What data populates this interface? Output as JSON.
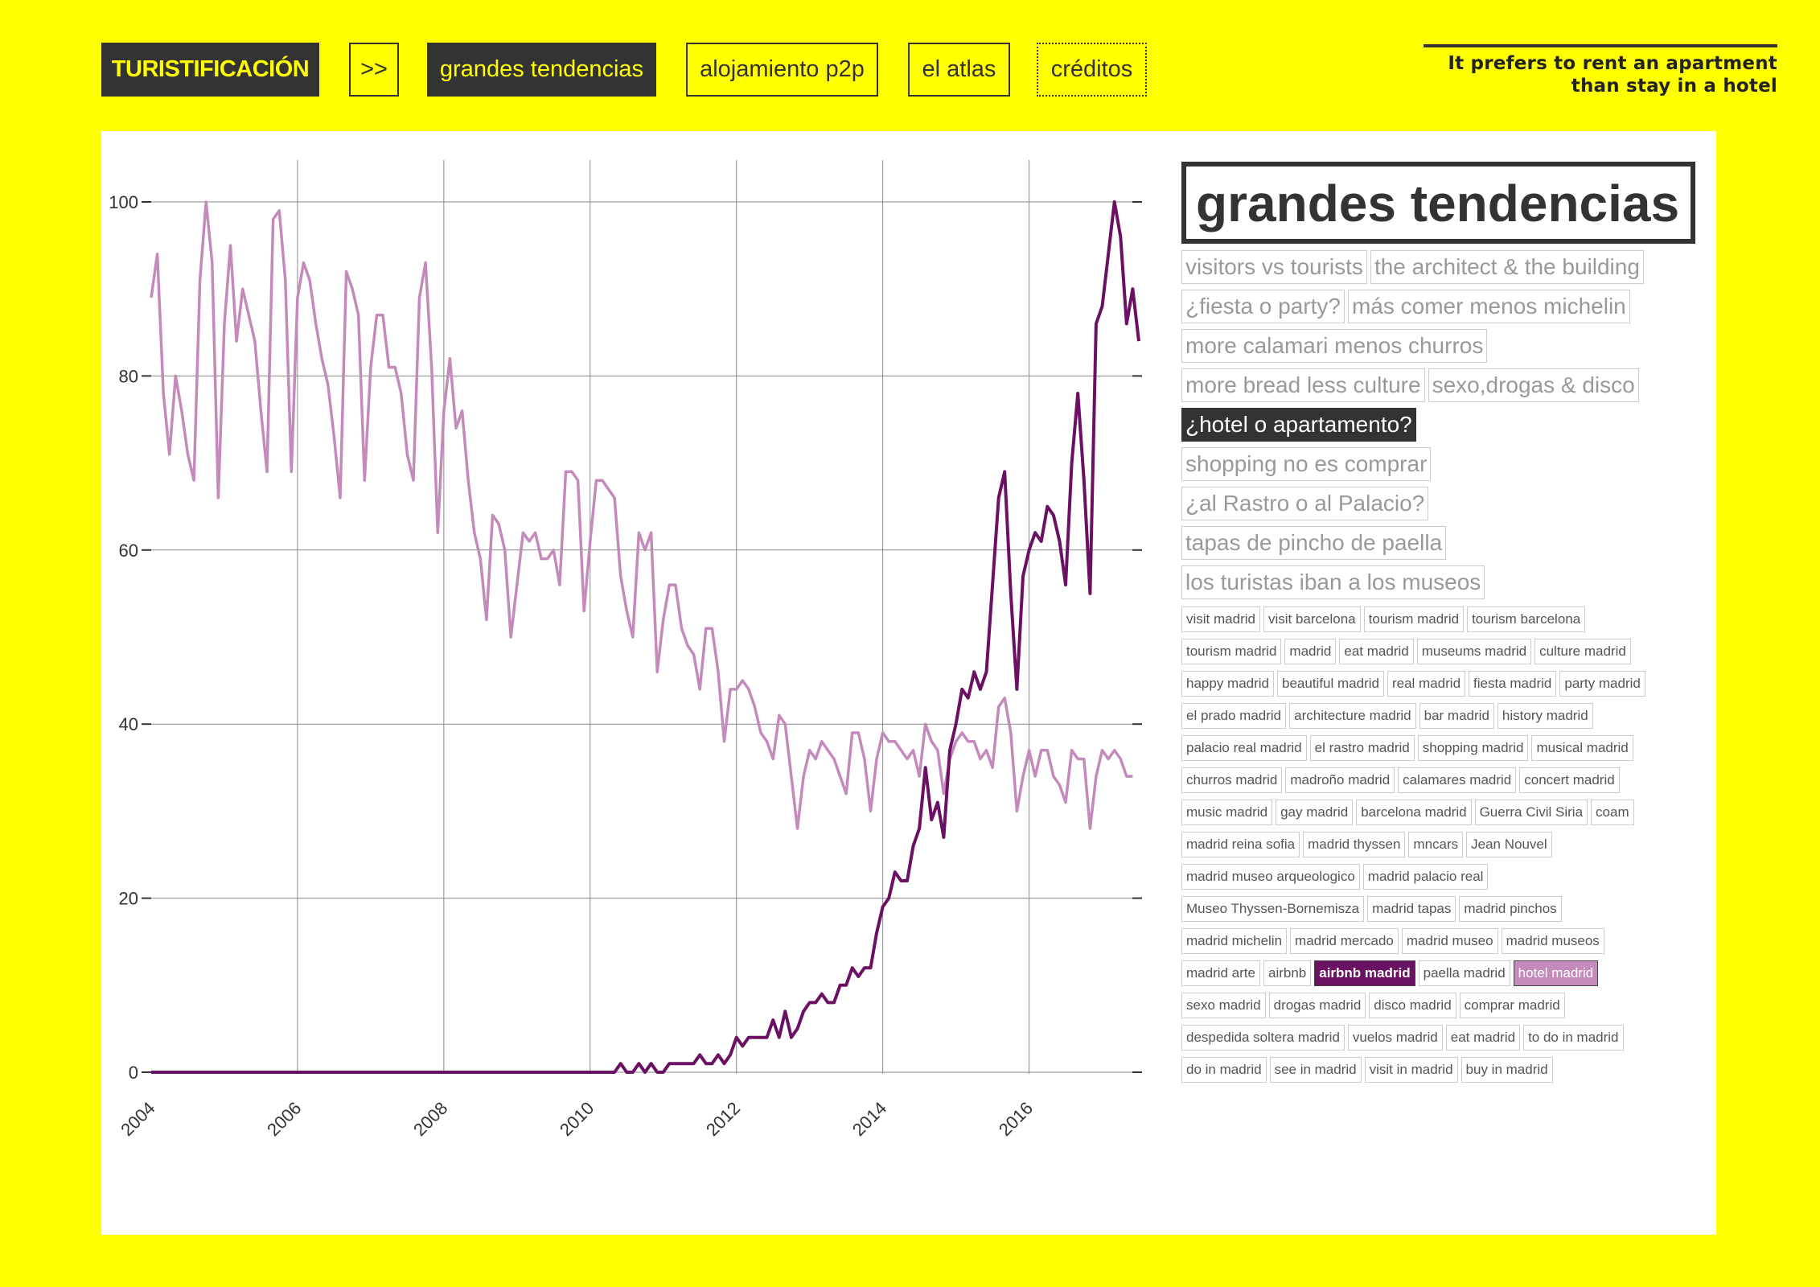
{
  "nav": {
    "brand": "TURISTIFICACIÓN",
    "arrow": ">>",
    "items": [
      "grandes tendencias",
      "alojamiento p2p",
      "el atlas",
      "créditos"
    ]
  },
  "tagline": "It prefers to rent an apartment than stay in a hotel",
  "sidebar": {
    "title": "grandes tendencias",
    "stories": [
      "visitors vs tourists",
      "the architect & the building",
      "¿fiesta o party?",
      "más comer menos michelin",
      "more calamari menos churros",
      "more bread less culture",
      "sexo,drogas & disco",
      "¿hotel o apartamento?",
      "shopping no es comprar",
      "¿al Rastro o al Palacio?",
      "tapas de pincho de paella",
      "los turistas iban a los museos"
    ],
    "active_story": "¿hotel o apartamento?",
    "keywords": [
      "visit madrid",
      "visit barcelona",
      "tourism madrid",
      "tourism barcelona",
      "tourism madrid",
      "madrid",
      "eat madrid",
      "museums madrid",
      "culture madrid",
      "happy madrid",
      "beautiful madrid",
      "real madrid",
      "fiesta madrid",
      "party madrid",
      "el prado madrid",
      "architecture madrid",
      "bar madrid",
      "history madrid",
      "palacio real madrid",
      "el rastro madrid",
      "shopping madrid",
      "musical madrid",
      "churros madrid",
      "madroño madrid",
      "calamares madrid",
      "concert madrid",
      "music madrid",
      "gay madrid",
      "barcelona madrid",
      "Guerra Civil Siria",
      "coam",
      "madrid reina sofia",
      "madrid thyssen",
      "mncars",
      "Jean Nouvel",
      "madrid museo arqueologico",
      "madrid palacio real",
      "Museo Thyssen-Bornemisza",
      "madrid tapas",
      "madrid pinchos",
      "madrid michelin",
      "madrid mercado",
      "madrid museo",
      "madrid museos",
      "madrid arte",
      "airbnb",
      "airbnb madrid",
      "paella madrid",
      "hotel madrid",
      "sexo madrid",
      "drogas madrid",
      "disco madrid",
      "comprar madrid",
      "despedida soltera madrid",
      "vuelos madrid",
      "eat madrid",
      "to do in madrid",
      "do in madrid",
      "see in madrid",
      "visit in madrid",
      "buy in madrid"
    ],
    "selected_keywords": {
      "airbnb madrid": "#6b1164",
      "hotel madrid": "#c48abb"
    }
  },
  "chart_data": {
    "type": "line",
    "x_ticks": [
      "2004",
      "2006",
      "2008",
      "2010",
      "2012",
      "2014",
      "2016"
    ],
    "y_ticks": [
      0,
      20,
      40,
      60,
      80,
      100
    ],
    "ylim": [
      0,
      100
    ],
    "xlim": [
      "2004-01",
      "2017-07"
    ],
    "grid": true,
    "series": [
      {
        "name": "hotel madrid",
        "color": "#c48abb",
        "start": "2004-01",
        "frequency": "monthly",
        "values": [
          89,
          94,
          78,
          71,
          80,
          76,
          71,
          68,
          91,
          100,
          93,
          66,
          86,
          95,
          84,
          90,
          87,
          84,
          76,
          69,
          98,
          99,
          91,
          69,
          89,
          93,
          91,
          86,
          82,
          79,
          73,
          66,
          92,
          90,
          87,
          68,
          81,
          87,
          87,
          81,
          81,
          78,
          71,
          68,
          89,
          93,
          81,
          62,
          76,
          82,
          74,
          76,
          68,
          62,
          59,
          52,
          64,
          63,
          60,
          50,
          56,
          62,
          61,
          62,
          59,
          59,
          60,
          56,
          69,
          69,
          68,
          53,
          61,
          68,
          68,
          67,
          66,
          57,
          53,
          50,
          62,
          60,
          62,
          46,
          52,
          56,
          56,
          51,
          49,
          48,
          44,
          51,
          51,
          46,
          38,
          44,
          44,
          45,
          44,
          42,
          39,
          38,
          36,
          41,
          40,
          34,
          28,
          34,
          37,
          36,
          38,
          37,
          36,
          34,
          32,
          39,
          39,
          36,
          30,
          36,
          39,
          38,
          38,
          37,
          36,
          37,
          34,
          40,
          38,
          37,
          32,
          36,
          38,
          39,
          38,
          38,
          36,
          37,
          35,
          42,
          43,
          39,
          30,
          34,
          37,
          34,
          37,
          37,
          34,
          33,
          31,
          37,
          36,
          36,
          28,
          34,
          37,
          36,
          37,
          36,
          34,
          34
        ]
      },
      {
        "name": "airbnb madrid",
        "color": "#6b1164",
        "start": "2004-01",
        "frequency": "monthly",
        "values": [
          0,
          0,
          0,
          0,
          0,
          0,
          0,
          0,
          0,
          0,
          0,
          0,
          0,
          0,
          0,
          0,
          0,
          0,
          0,
          0,
          0,
          0,
          0,
          0,
          0,
          0,
          0,
          0,
          0,
          0,
          0,
          0,
          0,
          0,
          0,
          0,
          0,
          0,
          0,
          0,
          0,
          0,
          0,
          0,
          0,
          0,
          0,
          0,
          0,
          0,
          0,
          0,
          0,
          0,
          0,
          0,
          0,
          0,
          0,
          0,
          0,
          0,
          0,
          0,
          0,
          0,
          0,
          0,
          0,
          0,
          0,
          0,
          0,
          0,
          0,
          0,
          0,
          1,
          0,
          0,
          1,
          0,
          1,
          0,
          0,
          1,
          1,
          1,
          1,
          1,
          2,
          1,
          1,
          2,
          1,
          2,
          4,
          3,
          4,
          4,
          4,
          4,
          6,
          4,
          7,
          4,
          5,
          7,
          8,
          8,
          9,
          8,
          8,
          10,
          10,
          12,
          11,
          12,
          12,
          16,
          19,
          20,
          23,
          22,
          22,
          26,
          28,
          35,
          29,
          31,
          27,
          37,
          40,
          44,
          43,
          46,
          44,
          46,
          56,
          66,
          69,
          55,
          44,
          57,
          60,
          62,
          61,
          65,
          64,
          61,
          56,
          70,
          78,
          68,
          55,
          86,
          88,
          94,
          100,
          96,
          86,
          90,
          84
        ]
      }
    ]
  }
}
